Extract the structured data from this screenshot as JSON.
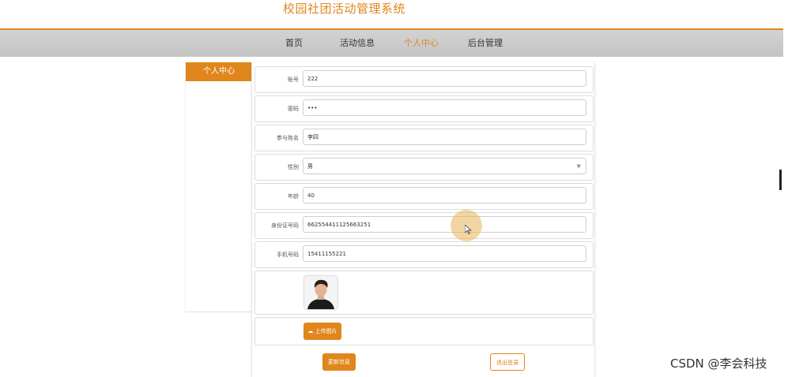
{
  "site": {
    "title": "校园社团活动管理系统"
  },
  "nav": {
    "items": [
      {
        "label": "首页",
        "active": false
      },
      {
        "label": "活动信息",
        "active": false
      },
      {
        "label": "个人中心",
        "active": true
      },
      {
        "label": "后台管理",
        "active": false
      }
    ]
  },
  "sidebar": {
    "header": "个人中心"
  },
  "form": {
    "account": {
      "label": "账号",
      "value": "222"
    },
    "password": {
      "label": "密码",
      "value": "•••"
    },
    "name": {
      "label": "参与姓名",
      "value": "李四"
    },
    "gender": {
      "label": "性别",
      "value": "男"
    },
    "age": {
      "label": "年龄",
      "value": "40"
    },
    "id_number": {
      "label": "身份证号码",
      "value": "662554411125663251"
    },
    "phone": {
      "label": "手机号码",
      "value": "15411155221"
    }
  },
  "buttons": {
    "upload": "上传图片",
    "update": "更新信息",
    "logout": "退出登录"
  },
  "watermark": "CSDN @李会科技",
  "colors": {
    "accent": "#e0861c",
    "nav_bg": "#c8c8c8"
  },
  "icons": {
    "upload": "cloud-upload-icon",
    "gender_dropdown": "chevron-down-icon"
  }
}
